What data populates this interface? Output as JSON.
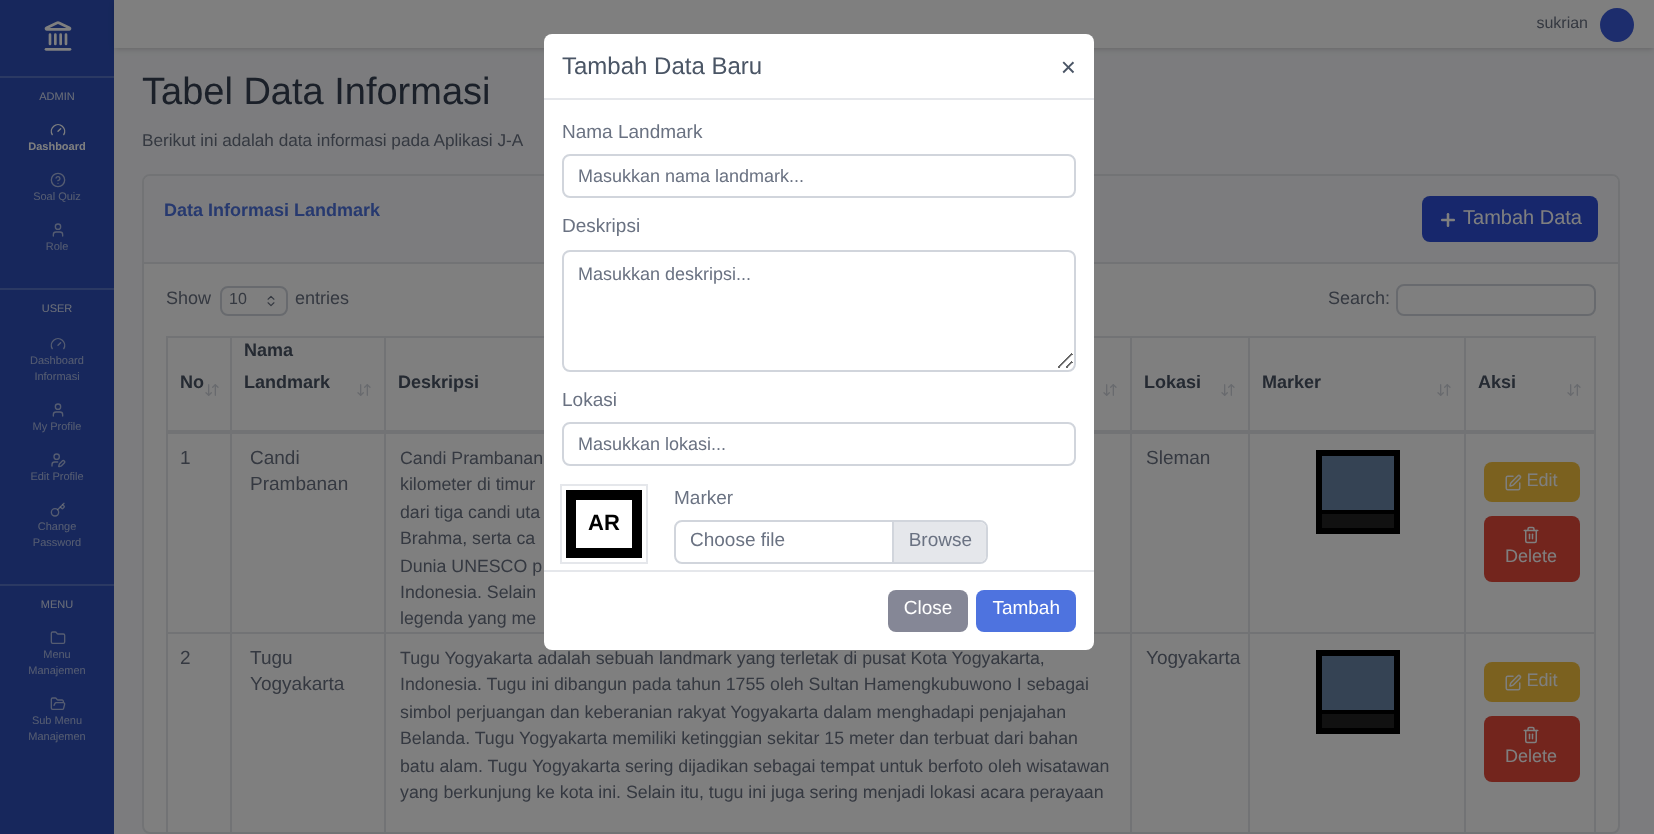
{
  "sidebar": {
    "sections": [
      {
        "heading": "ADMIN",
        "items": [
          {
            "label": "Dashboard",
            "selected": true
          },
          {
            "label": "Soal Quiz",
            "selected": false
          },
          {
            "label": "Role",
            "selected": false
          }
        ]
      },
      {
        "heading": "USER",
        "items": [
          {
            "label": "Dashboard Informasi",
            "selected": false
          },
          {
            "label": "My Profile",
            "selected": false
          },
          {
            "label": "Edit Profile",
            "selected": false
          },
          {
            "label": "Change Password",
            "selected": false
          }
        ]
      },
      {
        "heading": "MENU",
        "items": [
          {
            "label": "Menu Manajemen",
            "selected": false
          },
          {
            "label": "Sub Menu Manajemen",
            "selected": false
          }
        ]
      }
    ]
  },
  "topbar": {
    "user_name": "sukrian"
  },
  "page": {
    "title": "Tabel Data Informasi",
    "subtitle": "Berikut ini adalah data informasi pada Aplikasi J-A"
  },
  "card": {
    "title": "Data Informasi Landmark",
    "add_button": "Tambah Data",
    "show_label": "Show",
    "entries_value": "10",
    "entries_label": "entries",
    "search_label": "Search:"
  },
  "table": {
    "columns": [
      "No",
      "Nama Landmark",
      "Deskripsi",
      "Lokasi",
      "Marker",
      "Aksi"
    ],
    "rows": [
      {
        "no": "1",
        "name": "Candi Prambanan",
        "description_lines": [
          "Candi Prambanan",
          "kilometer di timur",
          "dari tiga candi uta",
          "Brahma, serta ca",
          "Dunia UNESCO p",
          "Indonesia. Selain",
          "legenda yang me"
        ],
        "location": "Sleman",
        "edit": "Edit",
        "delete": "Delete"
      },
      {
        "no": "2",
        "name": "Tugu Yogyakarta",
        "description_lines": [
          "Tugu Yogyakarta adalah sebuah landmark yang terletak di pusat Kota Yogyakarta,",
          "Indonesia. Tugu ini dibangun pada tahun 1755 oleh Sultan Hamengkubuwono I sebagai",
          "simbol perjuangan dan keberanian rakyat Yogyakarta dalam menghadapi penjajahan",
          "Belanda. Tugu Yogyakarta memiliki ketinggian sekitar 15 meter dan terbuat dari bahan",
          "batu alam. Tugu Yogyakarta sering dijadikan sebagai tempat untuk berfoto oleh wisatawan",
          "yang berkunjung ke kota ini. Selain itu, tugu ini juga sering menjadi lokasi acara perayaan"
        ],
        "location": "Yogyakarta",
        "edit": "Edit",
        "delete": "Delete"
      }
    ]
  },
  "modal": {
    "title": "Tambah Data Baru",
    "close_symbol": "×",
    "fields": [
      {
        "kind": "input",
        "label": "Nama Landmark",
        "placeholder": "Masukkan nama landmark..."
      },
      {
        "kind": "textarea",
        "label": "Deskripsi",
        "placeholder": "Masukkan deskripsi..."
      },
      {
        "kind": "input",
        "label": "Lokasi",
        "placeholder": "Masukkan lokasi..."
      }
    ],
    "marker": {
      "preview_text": "AR",
      "label": "Marker",
      "file_placeholder": "Choose file",
      "browse": "Browse"
    },
    "buttons": [
      {
        "kind": "secondary",
        "label": "Close"
      },
      {
        "kind": "primary",
        "label": "Tambah"
      }
    ]
  }
}
